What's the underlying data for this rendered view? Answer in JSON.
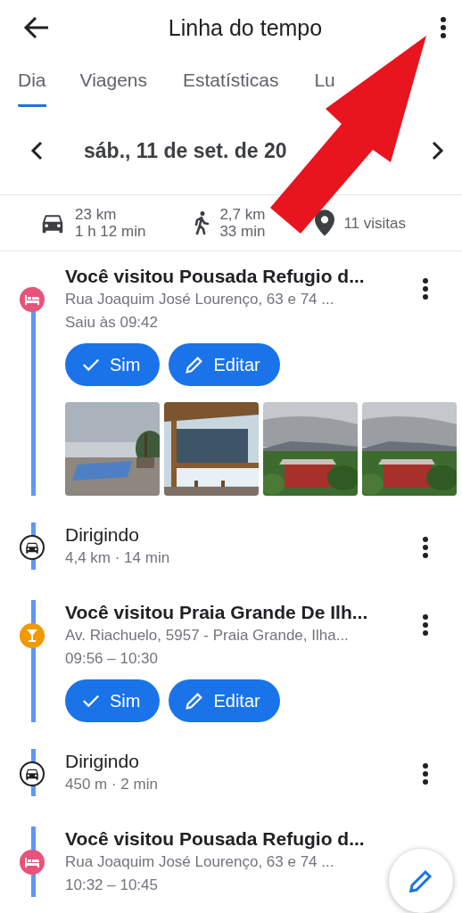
{
  "header": {
    "title": "Linha do tempo"
  },
  "tabs": [
    {
      "label": "Dia",
      "selected": true
    },
    {
      "label": "Viagens",
      "selected": false
    },
    {
      "label": "Estatísticas",
      "selected": false
    },
    {
      "label": "Lu",
      "selected": false
    }
  ],
  "date_bar": {
    "date": "sáb., 11 de set. de 20"
  },
  "summary": [
    {
      "line_1": "23 km",
      "line_2": "1 h 12 min"
    },
    {
      "line_1": "2,7 km",
      "line_2": "33 min"
    },
    {
      "line_1": "11 visitas"
    }
  ],
  "timeline": [
    {
      "kind": "lodging",
      "color": "#e8537a",
      "title": "Você visitou Pousada Refugio d...",
      "address": "Rua Joaquim José Lourenço, 63 e 74 ...",
      "time": "Saiu às 09:42",
      "menu": true,
      "actions": [
        "Sim",
        "Editar"
      ],
      "photos": [
        {
          "kind": "picture"
        },
        {
          "kind": "picture"
        },
        {
          "kind": "picture"
        },
        {
          "kind": "picture"
        }
      ]
    },
    {
      "kind": "drive",
      "title": "Dirigindo",
      "detail": "4,4 km · 14 min",
      "menu": true
    },
    {
      "kind": "bar",
      "color": "#f29900",
      "title": "Você visitou Praia Grande De Ilh...",
      "address": "Av. Riachuelo, 5957 - Praia Grande, Ilha...",
      "time": "09:56 – 10:30",
      "menu": true,
      "actions": [
        "Sim",
        "Editar"
      ]
    },
    {
      "kind": "drive",
      "title": "Dirigindo",
      "detail": "450 m · 2 min",
      "menu": true
    },
    {
      "kind": "lodging",
      "color": "#e8537a",
      "title": "Você visitou Pousada Refugio d...",
      "address": "Rua Joaquim José Lourenço, 63 e 74 ...",
      "time": "10:32 – 10:45",
      "menu": false
    }
  ]
}
